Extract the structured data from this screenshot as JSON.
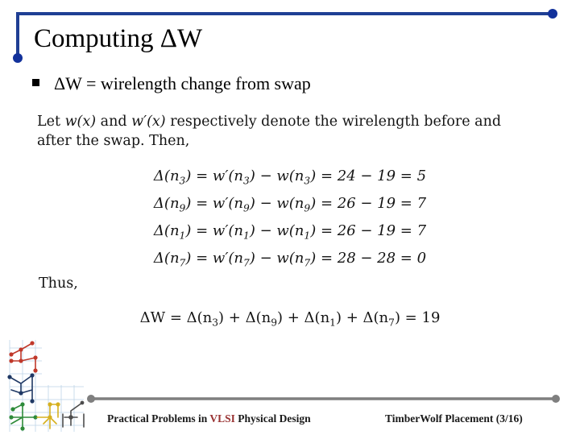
{
  "slide": {
    "title": "Computing ΔW",
    "bullet": {
      "marker": "square-bullet",
      "text": "ΔW = wirelength change from swap"
    },
    "lead_text_parts": {
      "a": "Let ",
      "w": "w(x)",
      "b": " and ",
      "wprime": "w′(x)",
      "c": " respectively denote the wirelength before and after the swap. Then,"
    },
    "thus_text": "Thus,",
    "equations": [
      {
        "lhs": "Δ(n3)",
        "net": "3",
        "expr": "= w′(n3) − w(n3) = 24 − 19 = 5",
        "wprime_value": 24,
        "w_value": 19,
        "delta": 5
      },
      {
        "lhs": "Δ(n9)",
        "net": "9",
        "expr": "= w′(n9) − w(n9) = 26 − 19 = 7",
        "wprime_value": 26,
        "w_value": 19,
        "delta": 7
      },
      {
        "lhs": "Δ(n1)",
        "net": "1",
        "expr": "= w′(n1) − w(n1) = 26 − 19 = 7",
        "wprime_value": 26,
        "w_value": 19,
        "delta": 7
      },
      {
        "lhs": "Δ(n7)",
        "net": "7",
        "expr": "= w′(n7) − w(n7) = 28 − 28 = 0",
        "wprime_value": 28,
        "w_value": 28,
        "delta": 0
      }
    ],
    "final_equation": {
      "text": "ΔW = Δ(n3) + Δ(n9) + Δ(n1) + Δ(n7) = 19",
      "total": 19
    }
  },
  "footer": {
    "left_prefix": "Practical Problems in ",
    "left_accent": "VLSI",
    "left_suffix": " Physical Design",
    "right": "TimberWolf Placement (3/16)"
  },
  "colors": {
    "title_rule": "#1F3F94",
    "title_rule_dot": "#12319B",
    "footer_rule": "#7F7F7F",
    "footer_accent": "#993333",
    "text": "#000000",
    "art_red": "#C0392B",
    "art_blue": "#1F3864",
    "art_green": "#2E8B3A",
    "art_yellow": "#D6B020",
    "art_gray": "#4D4D4D",
    "art_grid": "#BFD4E8"
  }
}
